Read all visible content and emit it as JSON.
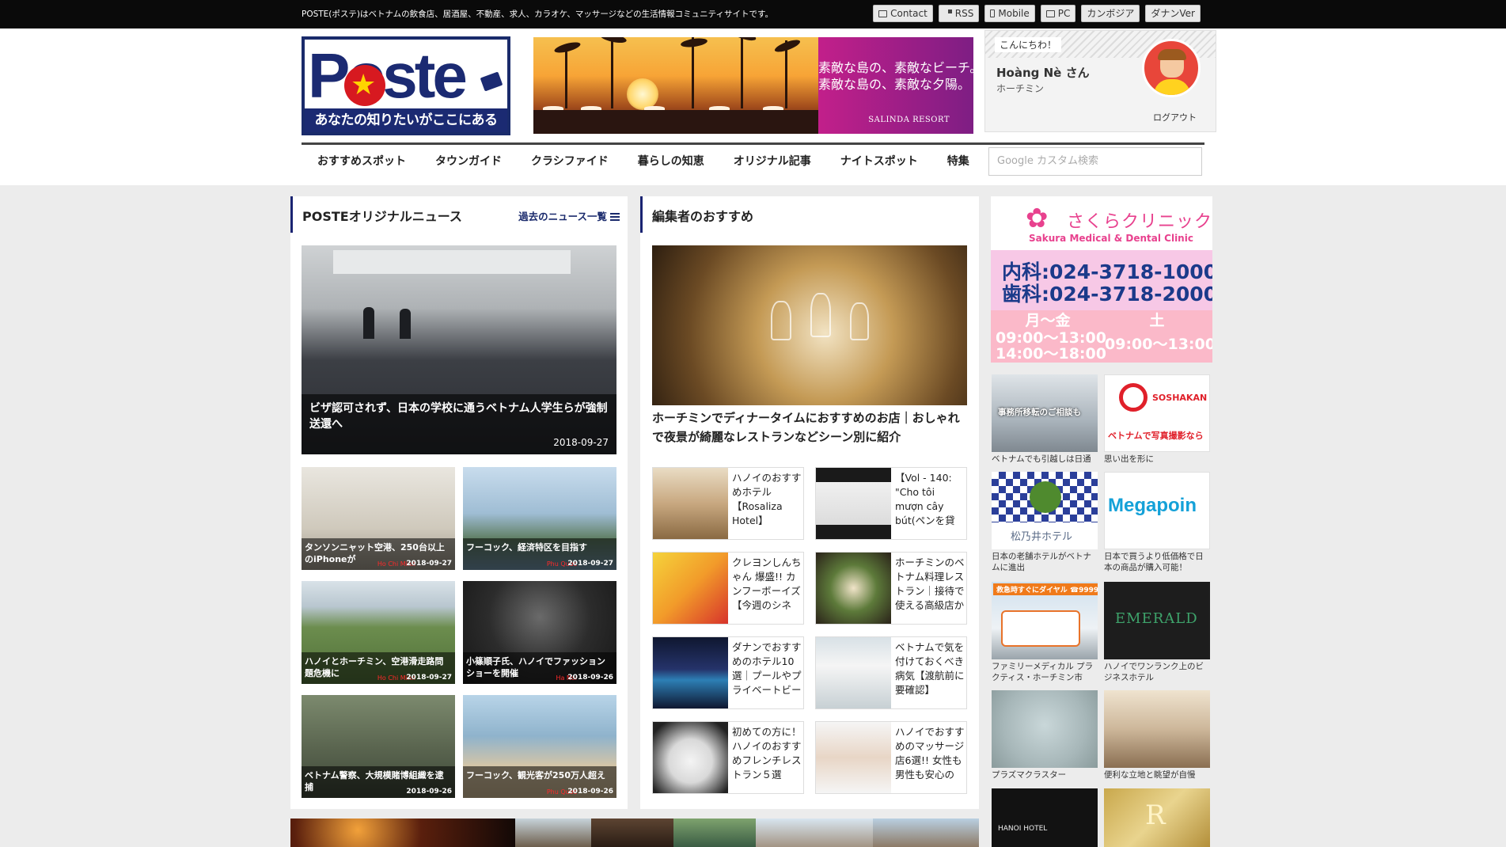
{
  "topbar": {
    "tagline": "POSTE(ポステ)はベトナムの飲食店、居酒屋、不動産、求人、カラオケ、マッサージなどの生活情報コミュニティサイトです。",
    "links": [
      {
        "label": "Contact",
        "icon": "mail-icon"
      },
      {
        "label": "RSS",
        "icon": "rss-icon"
      },
      {
        "label": "Mobile",
        "icon": "mobile-icon"
      },
      {
        "label": "PC",
        "icon": "desktop-icon"
      },
      {
        "label": "カンボジア"
      },
      {
        "label": "ダナンVer"
      }
    ]
  },
  "logo": {
    "text": "Poste",
    "tagline": "あなたの知りたいがここにある"
  },
  "banner": {
    "copy_line1": "素敵な島の、素敵なビーチ。",
    "copy_line2": "素敵な島の、素敵な夕陽。",
    "brand": "SALINDA RESORT"
  },
  "user": {
    "greeting": "こんにちわ！",
    "name": "Hoàng Nè さん",
    "city": "ホーチミン",
    "logout": "ログアウト"
  },
  "nav": [
    "おすすめスポット",
    "タウンガイド",
    "クラシファイド",
    "暮らしの知恵",
    "オリジナル記事",
    "ナイトスポット",
    "特集"
  ],
  "search": {
    "placeholder": "Google カスタム検索"
  },
  "news": {
    "title": "POSTEオリジナルニュース",
    "more": "過去のニュース一覧",
    "featured": {
      "title": "ビザ認可されず、日本の学校に通うベトナム人学生らが強制送還へ",
      "date": "2018-09-27"
    },
    "items": [
      {
        "title": "タンソンニャット空港、250台以上のiPhoneが",
        "location": "Ho Chi Minh",
        "date": "2018-09-27"
      },
      {
        "title": "フーコック、経済特区を目指す",
        "location": "Phu Quoc",
        "date": "2018-09-27"
      },
      {
        "title": "ハノイとホーチミン、空港滑走路問題危機に",
        "location": "Ho Chi Minh",
        "date": "2018-09-27"
      },
      {
        "title": "小篠順子氏、ハノイでファッションショーを開催",
        "location": "Ha Noi",
        "date": "2018-09-26"
      },
      {
        "title": "ベトナム警察、大規模賭博組織を逮捕",
        "location": "",
        "date": "2018-09-26"
      },
      {
        "title": "フーコック、観光客が250万人超え",
        "location": "Phu Quoc",
        "date": "2018-09-26"
      }
    ]
  },
  "editor": {
    "title": "編集者のおすすめ",
    "featured_title": "ホーチミンでディナータイムにおすすめのお店｜おしゃれで夜景が綺麗なレストランなどシーン別に紹介",
    "items": [
      {
        "title": "ハノイのおすすめホテル【Rosaliza Hotel】"
      },
      {
        "title": "【Vol - 140: \"Cho tôi mượn cây bút(ペンを貸"
      },
      {
        "title": "クレヨンしんちゃん 爆盛!! カンフーボーイズ【今週のシネ"
      },
      {
        "title": "ホーチミンのベトナム料理レストラン｜接待で使える高級店か"
      },
      {
        "title": "ダナンでおすすめのホテル10選｜プールやプライベートビー"
      },
      {
        "title": "ベトナムで気を付けておくべき病気【渡航前に要確認】"
      },
      {
        "title": "初めての方に！ハノイのおすすめフレンチレストラン５選"
      },
      {
        "title": "ハノイでおすすめのマッサージ店6選!! 女性も男性も安心の"
      }
    ]
  },
  "sidebar": {
    "sakura": {
      "name_jp": "さくらクリニック",
      "name_en": "Sakura Medical & Dental Clinic",
      "tel1": "内科:024-3718-1000",
      "tel2": "歯科:024-3718-2000",
      "days1": "月〜金",
      "hours1a": "09:00〜13:00",
      "hours1b": "14:00〜18:00",
      "days2": "土",
      "hours2": "09:00〜13:00"
    },
    "ads": [
      {
        "label": "ベトナムでも引越しは日通",
        "img_text": "事務所移転のご相談も"
      },
      {
        "label": "思い出を形に",
        "img_text": "ベトナムで写真撮影なら",
        "img_brand": "SOSHAKAN"
      },
      {
        "label": "日本の老舗ホテルがベトナムに進出",
        "img_text": "松乃井ホテル"
      },
      {
        "label": "日本で買うより低価格で日本の商品が購入可能！",
        "img_text": "Megapoin"
      },
      {
        "label": "ファミリーメディカル プラクティス・ホーチミン市",
        "img_text": "救急時すぐにダイヤル ☎9999"
      },
      {
        "label": "ハノイでワンランク上のビジネスホテル",
        "img_text": "EMERALD"
      },
      {
        "label": "プラズマクラスター",
        "img_text": ""
      },
      {
        "label": "便利な立地と眺望が自慢",
        "img_text": ""
      },
      {
        "label": "",
        "img_text": "HANOI HOTEL"
      },
      {
        "label": "",
        "img_text": "R"
      }
    ]
  }
}
